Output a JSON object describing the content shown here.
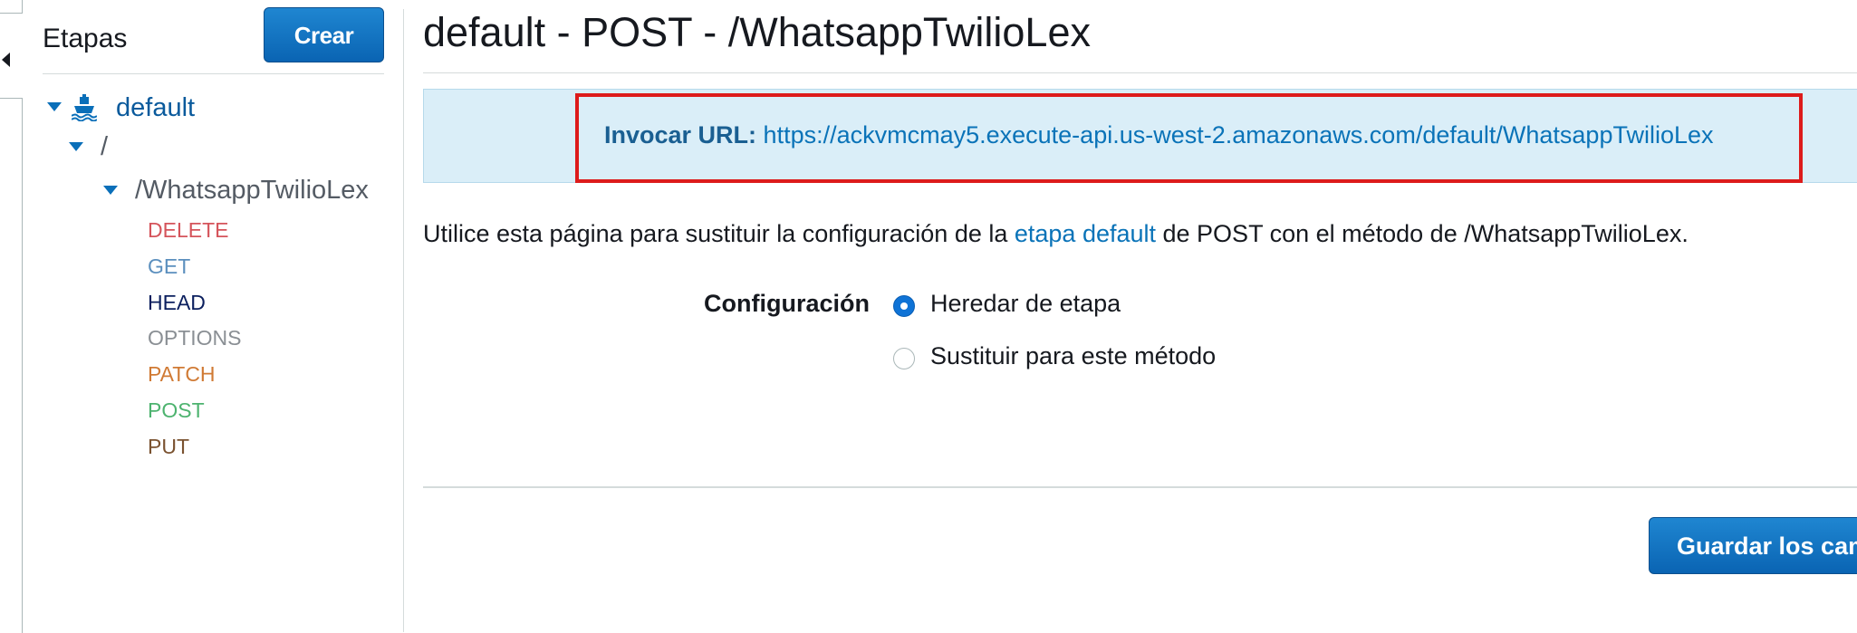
{
  "sidebar": {
    "title": "Etapas",
    "create_label": "Crear",
    "tree": {
      "stage": "default",
      "root": "/",
      "resource": "/WhatsappTwilioLex",
      "methods": [
        {
          "label": "DELETE",
          "color": "#d5545b"
        },
        {
          "label": "GET",
          "color": "#5b8fbe"
        },
        {
          "label": "HEAD",
          "color": "#0b1f5e"
        },
        {
          "label": "OPTIONS",
          "color": "#8a8f94"
        },
        {
          "label": "PATCH",
          "color": "#d07a34"
        },
        {
          "label": "POST",
          "color": "#4db36f"
        },
        {
          "label": "PUT",
          "color": "#7a5230"
        }
      ]
    }
  },
  "main": {
    "title": "default - POST - /WhatsappTwilioLex",
    "invoke": {
      "label": "Invocar URL:",
      "url": "https://ackvmcmay5.execute-api.us-west-2.amazonaws.com/default/WhatsappTwilioLex"
    },
    "description": {
      "before": "Utilice esta página para sustituir la configuración de la ",
      "link": "etapa default",
      "after": " de POST con el método de /WhatsappTwilioLex."
    },
    "config": {
      "label": "Configuración",
      "options": [
        "Heredar de etapa",
        "Sustituir para este método"
      ],
      "selected": "Heredar de etapa"
    },
    "save_label": "Guardar los cambios"
  },
  "colors": {
    "accent": "#0a73b8",
    "highlight_border": "#dd1b1b",
    "info_bg": "#daeef8"
  }
}
